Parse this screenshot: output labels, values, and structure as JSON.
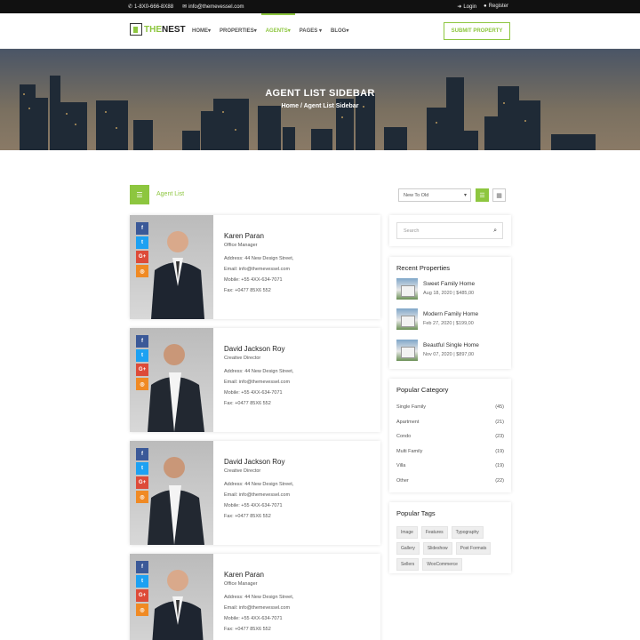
{
  "topbar": {
    "phone": "1-8X0-666-8X88",
    "email": "info@themevessel.com",
    "login": "Login",
    "register": "Register"
  },
  "brand": {
    "logo_the": "THE",
    "logo_nest": "NEST"
  },
  "nav": {
    "items": [
      "HOME",
      "PROPERTIES",
      "AGENTS",
      "PAGES",
      "BLOG"
    ],
    "active": "AGENTS",
    "submit_label": "SUBMIT PROPERTY"
  },
  "hero": {
    "title": "AGENT LIST SIDEBAR",
    "breadcrumb_home": "Home",
    "breadcrumb_sep": "/",
    "breadcrumb_current": "Agent List Sidebar"
  },
  "listing": {
    "label": "Agent List",
    "sort_value": "New To Old"
  },
  "agents": [
    {
      "name": "Karen Paran",
      "role": "Office Manager",
      "address": "Address: 44 New Design Street,",
      "email": "Email: info@themevessel.com",
      "mobile": "Mobile: +55 4XX-634-7071",
      "fax": "Fax: +0477 85X6 552"
    },
    {
      "name": "David Jackson Roy",
      "role": "Creative Director",
      "address": "Address: 44 New Design Street,",
      "email": "Email: info@themevessel.com",
      "mobile": "Mobile: +55 4XX-634-7071",
      "fax": "Fax: +0477 85X6 552"
    },
    {
      "name": "David Jackson Roy",
      "role": "Creative Director",
      "address": "Address: 44 New Design Street,",
      "email": "Email: info@themevessel.com",
      "mobile": "Mobile: +55 4XX-634-7071",
      "fax": "Fax: +0477 85X6 552"
    },
    {
      "name": "Karen Paran",
      "role": "Office Manager",
      "address": "Address: 44 New Design Street,",
      "email": "Email: info@themevessel.com",
      "mobile": "Mobile: +55 4XX-634-7071",
      "fax": "Fax: +0477 85X6 552"
    }
  ],
  "sidebar": {
    "search_placeholder": "Search",
    "recent_title": "Recent Properties",
    "recent": [
      {
        "name": "Sweet Family Home",
        "meta": "Aug 18, 2020 | $485,00"
      },
      {
        "name": "Modern Family Home",
        "meta": "Feb 27, 2020 | $199,00"
      },
      {
        "name": "Beautful Single Home",
        "meta": "Nov 07, 2020 | $897,00"
      }
    ],
    "category_title": "Popular Category",
    "categories": [
      {
        "name": "Single Family",
        "count": "(45)"
      },
      {
        "name": "Apartment",
        "count": "(21)"
      },
      {
        "name": "Condo",
        "count": "(23)"
      },
      {
        "name": "Multi Family",
        "count": "(19)"
      },
      {
        "name": "Villa",
        "count": "(19)"
      },
      {
        "name": "Other",
        "count": "(22)"
      }
    ],
    "tags_title": "Popular Tags",
    "tags": [
      "Image",
      "Features",
      "Typography",
      "Gallery",
      "Slideshow",
      "Post Formats",
      "Sellers",
      "WooCommerce"
    ]
  },
  "colors": {
    "accent": "#8dc63f",
    "facebook": "#3b5998",
    "twitter": "#1da1f2",
    "google": "#dd4b39",
    "dribbble": "#f08a24"
  }
}
